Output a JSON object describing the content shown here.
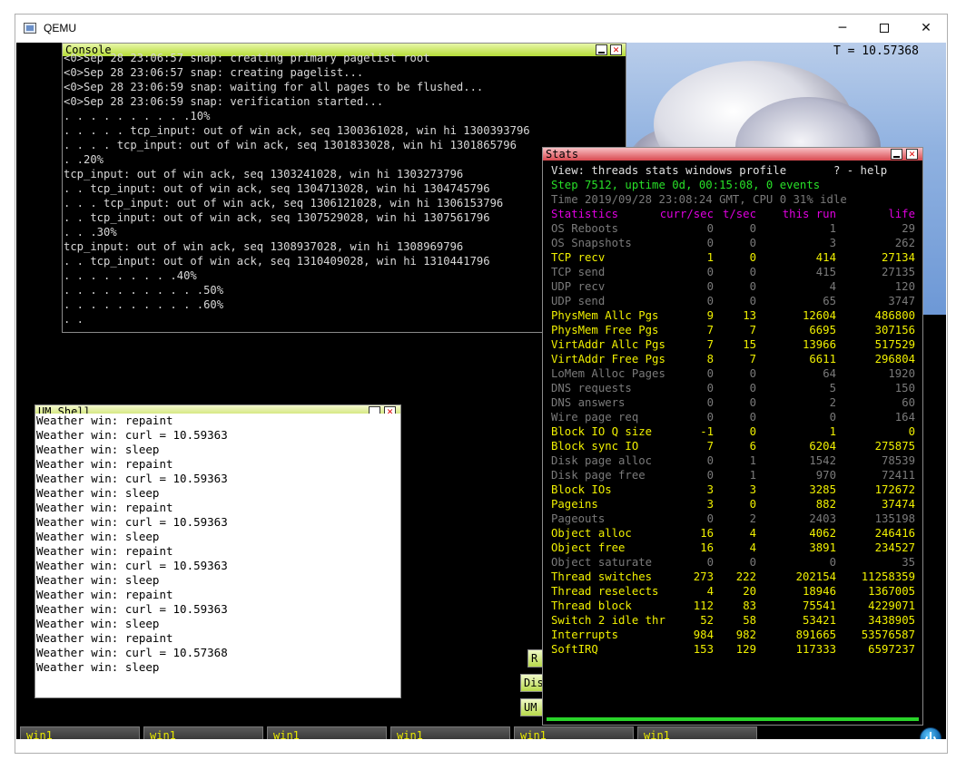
{
  "window": {
    "title": "QEMU",
    "minimize": "─",
    "close": "✕"
  },
  "timer": "T = 10.57368",
  "console": {
    "title": "Console",
    "lines": [
      "<0>Sep 28 23:06:57 snap: creating primary pagelist root",
      "<0>Sep 28 23:06:57 snap: creating pagelist...",
      "<0>Sep 28 23:06:59 snap: waiting for all pages to be flushed...",
      "<0>Sep 28 23:06:59 snap: verification started...",
      ". . . . . . . . . .10%",
      ". . . . . tcp_input: out of win ack, seq 1300361028, win hi 1300393796",
      ". . . . tcp_input: out of win ack, seq 1301833028, win hi 1301865796",
      ". .20%",
      "tcp_input: out of win ack, seq 1303241028, win hi 1303273796",
      ". . tcp_input: out of win ack, seq 1304713028, win hi 1304745796",
      ". . . tcp_input: out of win ack, seq 1306121028, win hi 1306153796",
      ". . tcp_input: out of win ack, seq 1307529028, win hi 1307561796",
      ". . .30%",
      "tcp_input: out of win ack, seq 1308937028, win hi 1308969796",
      ". . tcp_input: out of win ack, seq 1310409028, win hi 1310441796",
      ". . . . . . . . .40%",
      ". . . . . . . . . . .50%",
      ". . . . . . . . . . .60%",
      ". ."
    ]
  },
  "umshell": {
    "title": "UM Shell",
    "lines": [
      "Weather win: repaint",
      "Weather win: curl = 10.59363",
      "Weather win: sleep",
      "Weather win: repaint",
      "Weather win: curl = 10.59363",
      "Weather win: sleep",
      "Weather win: repaint",
      "Weather win: curl = 10.59363",
      "Weather win: sleep",
      "Weather win: repaint",
      "Weather win: curl = 10.59363",
      "Weather win: sleep",
      "Weather win: repaint",
      "Weather win: curl = 10.59363",
      "Weather win: sleep",
      "Weather win: repaint",
      "Weather win: curl = 10.57368",
      "Weather win: sleep"
    ]
  },
  "stats": {
    "title": "Stats",
    "view_line": "View: threads stats windows profile       ? - help",
    "step_line": "Step 7512, uptime 0d, 00:15:08, 0 events",
    "time_line": "Time 2019/09/28 23:08:24 GMT, CPU 0 31% idle",
    "header": {
      "name": "Statistics",
      "cur": "curr/sec",
      "t": "t/sec",
      "run": "this run",
      "life": "life"
    },
    "rows": [
      {
        "name": "OS Reboots",
        "cur": "0",
        "t": "0",
        "run": "1",
        "life": "29",
        "color": "grey"
      },
      {
        "name": "OS Snapshots",
        "cur": "0",
        "t": "0",
        "run": "3",
        "life": "262",
        "color": "grey"
      },
      {
        "name": "TCP recv",
        "cur": "1",
        "t": "0",
        "run": "414",
        "life": "27134",
        "color": "yellow"
      },
      {
        "name": "TCP send",
        "cur": "0",
        "t": "0",
        "run": "415",
        "life": "27135",
        "color": "grey"
      },
      {
        "name": "UDP recv",
        "cur": "0",
        "t": "0",
        "run": "4",
        "life": "120",
        "color": "grey"
      },
      {
        "name": "UDP send",
        "cur": "0",
        "t": "0",
        "run": "65",
        "life": "3747",
        "color": "grey"
      },
      {
        "name": "PhysMem Allc Pgs",
        "cur": "9",
        "t": "13",
        "run": "12604",
        "life": "486800",
        "color": "yellow"
      },
      {
        "name": "PhysMem Free Pgs",
        "cur": "7",
        "t": "7",
        "run": "6695",
        "life": "307156",
        "color": "yellow"
      },
      {
        "name": "VirtAddr Allc Pgs",
        "cur": "7",
        "t": "15",
        "run": "13966",
        "life": "517529",
        "color": "yellow"
      },
      {
        "name": "VirtAddr Free Pgs",
        "cur": "8",
        "t": "7",
        "run": "6611",
        "life": "296804",
        "color": "yellow"
      },
      {
        "name": "LoMem Alloc Pages",
        "cur": "0",
        "t": "0",
        "run": "64",
        "life": "1920",
        "color": "grey"
      },
      {
        "name": "DNS requests",
        "cur": "0",
        "t": "0",
        "run": "5",
        "life": "150",
        "color": "grey"
      },
      {
        "name": "DNS answers",
        "cur": "0",
        "t": "0",
        "run": "2",
        "life": "60",
        "color": "grey"
      },
      {
        "name": "Wire page req",
        "cur": "0",
        "t": "0",
        "run": "0",
        "life": "164",
        "color": "grey"
      },
      {
        "name": "Block IO Q size",
        "cur": "-1",
        "t": "0",
        "run": "1",
        "life": "0",
        "color": "yellow"
      },
      {
        "name": "Block sync IO",
        "cur": "7",
        "t": "6",
        "run": "6204",
        "life": "275875",
        "color": "yellow"
      },
      {
        "name": "Disk page alloc",
        "cur": "0",
        "t": "1",
        "run": "1542",
        "life": "78539",
        "color": "grey"
      },
      {
        "name": "Disk page free",
        "cur": "0",
        "t": "1",
        "run": "970",
        "life": "72411",
        "color": "grey"
      },
      {
        "name": "Block IOs",
        "cur": "3",
        "t": "3",
        "run": "3285",
        "life": "172672",
        "color": "yellow"
      },
      {
        "name": "Pageins",
        "cur": "3",
        "t": "0",
        "run": "882",
        "life": "37474",
        "color": "yellow"
      },
      {
        "name": "Pageouts",
        "cur": "0",
        "t": "2",
        "run": "2403",
        "life": "135198",
        "color": "grey"
      },
      {
        "name": "Object alloc",
        "cur": "16",
        "t": "4",
        "run": "4062",
        "life": "246416",
        "color": "yellow"
      },
      {
        "name": "Object free",
        "cur": "16",
        "t": "4",
        "run": "3891",
        "life": "234527",
        "color": "yellow"
      },
      {
        "name": "Object saturate",
        "cur": "0",
        "t": "0",
        "run": "0",
        "life": "35",
        "color": "grey"
      },
      {
        "name": "Thread switches",
        "cur": "273",
        "t": "222",
        "run": "202154",
        "life": "11258359",
        "color": "yellow"
      },
      {
        "name": "Thread reselects",
        "cur": "4",
        "t": "20",
        "run": "18946",
        "life": "1367005",
        "color": "yellow"
      },
      {
        "name": "Thread block",
        "cur": "112",
        "t": "83",
        "run": "75541",
        "life": "4229071",
        "color": "yellow"
      },
      {
        "name": "Switch 2 idle thr",
        "cur": "52",
        "t": "58",
        "run": "53421",
        "life": "3438905",
        "color": "yellow"
      },
      {
        "name": "Interrupts",
        "cur": "984",
        "t": "982",
        "run": "891665",
        "life": "53576587",
        "color": "yellow"
      },
      {
        "name": "SoftIRQ",
        "cur": "153",
        "t": "129",
        "run": "117333",
        "life": "6597237",
        "color": "yellow"
      }
    ]
  },
  "side_buttons": [
    "R",
    "Dis",
    "UM"
  ],
  "taskbar": [
    "win1",
    "win1",
    "win1",
    "win1",
    "win1",
    "win1"
  ]
}
